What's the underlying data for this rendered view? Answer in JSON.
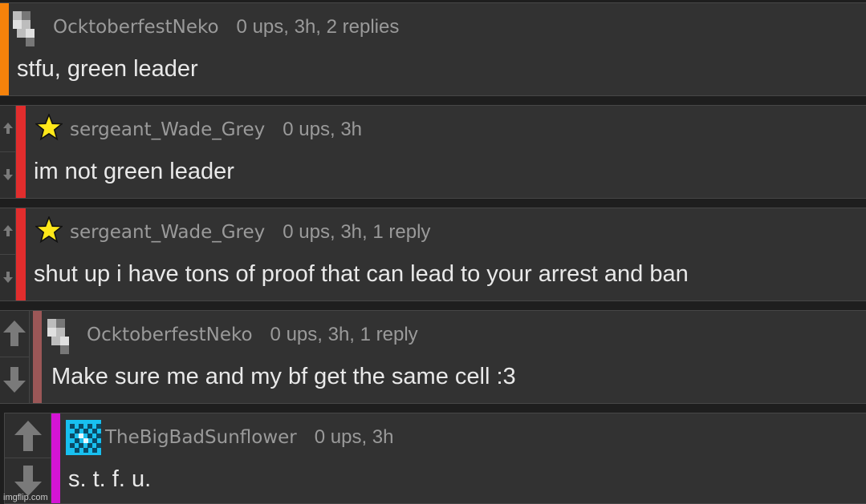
{
  "colors": {
    "orange": "#f5820b",
    "red": "#e12d2d",
    "mauve": "#9b5757",
    "magenta": "#d414d4",
    "star": "#ffe81a",
    "cyan_avatar": "#18c0f0"
  },
  "comments": [
    {
      "user": "OcktoberfestNeko",
      "stats": "0 ups, 3h, 2 replies",
      "text": "stfu, green leader",
      "avatar": "pixel-avatar-icon"
    },
    {
      "user": "sergeant_Wade_Grey",
      "stats": "0 ups, 3h",
      "text": "im not green leader",
      "avatar": "star-icon"
    },
    {
      "user": "sergeant_Wade_Grey",
      "stats": "0 ups, 3h, 1 reply",
      "text": "shut up i have tons of proof that can lead to your arrest and ban",
      "avatar": "star-icon"
    },
    {
      "user": "OcktoberfestNeko",
      "stats": "0 ups, 3h, 1 reply",
      "text": "Make sure me and my bf get the same cell :3",
      "avatar": "pixel-avatar-icon"
    },
    {
      "user": "TheBigBadSunflower",
      "stats": "0 ups, 3h",
      "text": "s. t. f. u.",
      "avatar": "checker-avatar-icon"
    }
  ],
  "watermark": "imgflip.com"
}
